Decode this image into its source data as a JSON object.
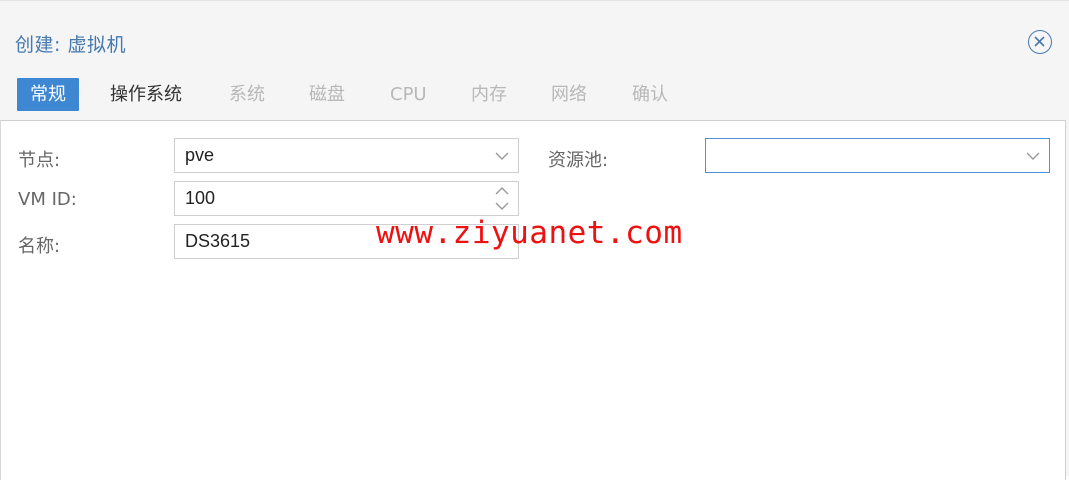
{
  "dialog": {
    "title": "创建: 虚拟机",
    "close_icon": "close-circle-icon"
  },
  "tabs": [
    {
      "label": "常规",
      "state": "active"
    },
    {
      "label": "操作系统",
      "state": "enabled"
    },
    {
      "label": "系统",
      "state": "disabled"
    },
    {
      "label": "磁盘",
      "state": "disabled"
    },
    {
      "label": "CPU",
      "state": "disabled"
    },
    {
      "label": "内存",
      "state": "disabled"
    },
    {
      "label": "网络",
      "state": "disabled"
    },
    {
      "label": "确认",
      "state": "disabled"
    }
  ],
  "form": {
    "node": {
      "label": "节点:",
      "value": "pve"
    },
    "vmid": {
      "label": "VM ID:",
      "value": "100"
    },
    "name": {
      "label": "名称:",
      "value": "DS3615"
    },
    "pool": {
      "label": "资源池:",
      "value": ""
    }
  },
  "watermark": "www.ziyuanet.com",
  "colors": {
    "accent": "#3e87d2",
    "title": "#4579b0",
    "watermark": "#ee1111",
    "disabled_tab": "#b8b8b8"
  }
}
